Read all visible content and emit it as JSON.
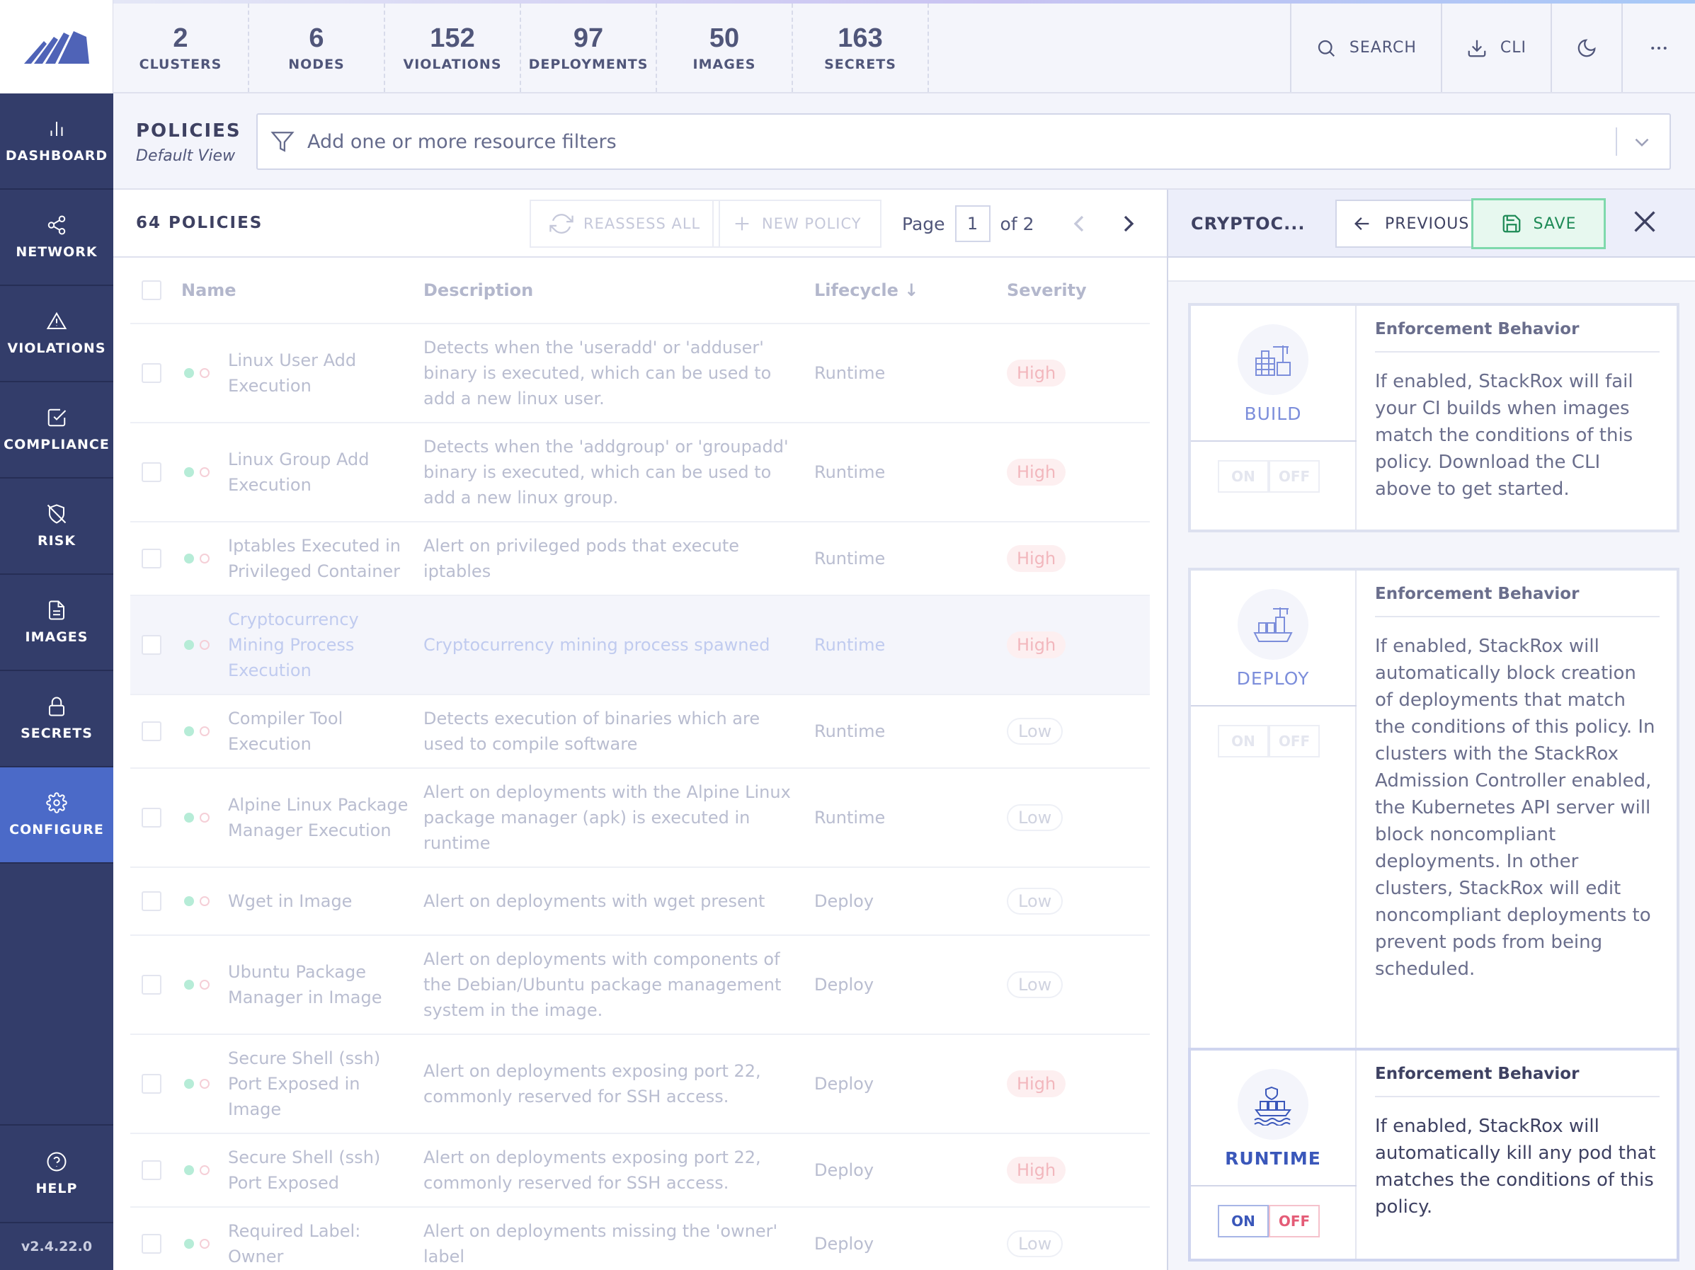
{
  "nav": {
    "items": [
      {
        "label": "DASHBOARD",
        "icon": "bar-chart-icon"
      },
      {
        "label": "NETWORK",
        "icon": "share-icon"
      },
      {
        "label": "VIOLATIONS",
        "icon": "alert-triangle-icon"
      },
      {
        "label": "COMPLIANCE",
        "icon": "check-square-icon"
      },
      {
        "label": "RISK",
        "icon": "shield-off-icon"
      },
      {
        "label": "IMAGES",
        "icon": "file-icon"
      },
      {
        "label": "SECRETS",
        "icon": "lock-icon"
      },
      {
        "label": "CONFIGURE",
        "icon": "gear-icon",
        "active": true
      }
    ],
    "help": "HELP",
    "version": "v2.4.22.0"
  },
  "summary": [
    {
      "value": "2",
      "label": "CLUSTERS"
    },
    {
      "value": "6",
      "label": "NODES"
    },
    {
      "value": "152",
      "label": "VIOLATIONS"
    },
    {
      "value": "97",
      "label": "DEPLOYMENTS"
    },
    {
      "value": "50",
      "label": "IMAGES"
    },
    {
      "value": "163",
      "label": "SECRETS"
    }
  ],
  "toolbar": {
    "search": "SEARCH",
    "cli": "CLI"
  },
  "page": {
    "title": "POLICIES",
    "subtitle": "Default View"
  },
  "filter": {
    "placeholder": "Add one or more resource filters"
  },
  "list": {
    "count_label": "64 POLICIES",
    "reassess": "REASSESS ALL",
    "new_policy": "NEW POLICY",
    "page_label": "Page",
    "page_value": "1",
    "page_of": "of 2",
    "columns": {
      "name": "Name",
      "description": "Description",
      "lifecycle": "Lifecycle ↓",
      "severity": "Severity"
    },
    "rows": [
      {
        "name": "Linux User Add Execution",
        "description": "Detects when the 'useradd' or 'adduser' binary is executed, which can be used to add a new linux user.",
        "lifecycle": "Runtime",
        "severity": "High"
      },
      {
        "name": "Linux Group Add Execution",
        "description": "Detects when the 'addgroup' or 'groupadd' binary is executed, which can be used to add a new linux group.",
        "lifecycle": "Runtime",
        "severity": "High"
      },
      {
        "name": "Iptables Executed in Privileged Container",
        "description": "Alert on privileged pods that execute iptables",
        "lifecycle": "Runtime",
        "severity": "High"
      },
      {
        "name": "Cryptocurrency Mining Process Execution",
        "description": "Cryptocurrency mining process spawned",
        "lifecycle": "Runtime",
        "severity": "High"
      },
      {
        "name": "Compiler Tool Execution",
        "description": "Detects execution of binaries which are used to compile software",
        "lifecycle": "Runtime",
        "severity": "Low"
      },
      {
        "name": "Alpine Linux Package Manager Execution",
        "description": "Alert on deployments with the Alpine Linux package manager (apk) is executed in runtime",
        "lifecycle": "Runtime",
        "severity": "Low"
      },
      {
        "name": "Wget in Image",
        "description": "Alert on deployments with wget present",
        "lifecycle": "Deploy",
        "severity": "Low"
      },
      {
        "name": "Ubuntu Package Manager in Image",
        "description": "Alert on deployments with components of the Debian/Ubuntu package management system in the image.",
        "lifecycle": "Deploy",
        "severity": "Low"
      },
      {
        "name": "Secure Shell (ssh) Port Exposed in Image",
        "description": "Alert on deployments exposing port 22, commonly reserved for SSH access.",
        "lifecycle": "Deploy",
        "severity": "High"
      },
      {
        "name": "Secure Shell (ssh) Port Exposed",
        "description": "Alert on deployments exposing port 22, commonly reserved for SSH access.",
        "lifecycle": "Deploy",
        "severity": "High"
      },
      {
        "name": "Required Label: Owner",
        "description": "Alert on deployments missing the 'owner' label",
        "lifecycle": "Deploy",
        "severity": "Low"
      }
    ]
  },
  "panel": {
    "title": "CRYPTOC...",
    "previous": "PREVIOUS",
    "save": "SAVE",
    "cards": [
      {
        "stage": "BUILD",
        "heading": "Enforcement Behavior",
        "text": "If enabled, StackRox will fail your CI builds when images match the conditions of this policy. Download the CLI above to get started.",
        "on": "ON",
        "off": "OFF"
      },
      {
        "stage": "DEPLOY",
        "heading": "Enforcement Behavior",
        "text": "If enabled, StackRox will automatically block creation of deployments that match the conditions of this policy. In clusters with the StackRox Admission Controller enabled, the Kubernetes API server will block noncompliant deployments. In other clusters, StackRox will edit noncompliant deployments to prevent pods from being scheduled.",
        "on": "ON",
        "off": "OFF"
      },
      {
        "stage": "RUNTIME",
        "heading": "Enforcement Behavior",
        "text": "If enabled, StackRox will automatically kill any pod that matches the conditions of this policy.",
        "on": "ON",
        "off": "OFF"
      }
    ]
  }
}
